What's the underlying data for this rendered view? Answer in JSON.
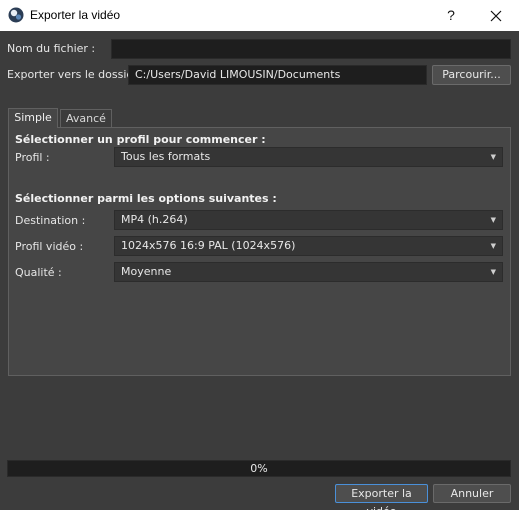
{
  "window": {
    "title": "Exporter la vidéo",
    "help_glyph": "?",
    "close_glyph": "✕"
  },
  "filename": {
    "label": "Nom du fichier :",
    "value": ""
  },
  "folder": {
    "label": "Exporter vers le dossier",
    "value": "C:/Users/David LIMOUSIN/Documents",
    "browse_label": "Parcourir..."
  },
  "tabs": [
    {
      "label": "Simple",
      "active": true
    },
    {
      "label": "Avancé",
      "active": false
    }
  ],
  "simple": {
    "profile_heading": "Sélectionner un profil pour commencer :",
    "profile_label": "Profil :",
    "profile_value": "Tous les formats",
    "options_heading": "Sélectionner parmi les options suivantes :",
    "destination_label": "Destination :",
    "destination_value": "MP4 (h.264)",
    "video_profile_label": "Profil vidéo :",
    "video_profile_value": "1024x576 16:9 PAL (1024x576)",
    "quality_label": "Qualité :",
    "quality_value": "Moyenne"
  },
  "progress": {
    "value": 0,
    "text": "0%"
  },
  "footer": {
    "export_label": "Exporter la vidéo",
    "cancel_label": "Annuler"
  },
  "colors": {
    "background": "#3c3c3c",
    "panel": "#464646",
    "field": "#1e1e1e",
    "accent": "#4a90d9"
  },
  "icons": {
    "app": "openshot-logo-icon",
    "combo_arrow": "chevron-down-icon"
  }
}
